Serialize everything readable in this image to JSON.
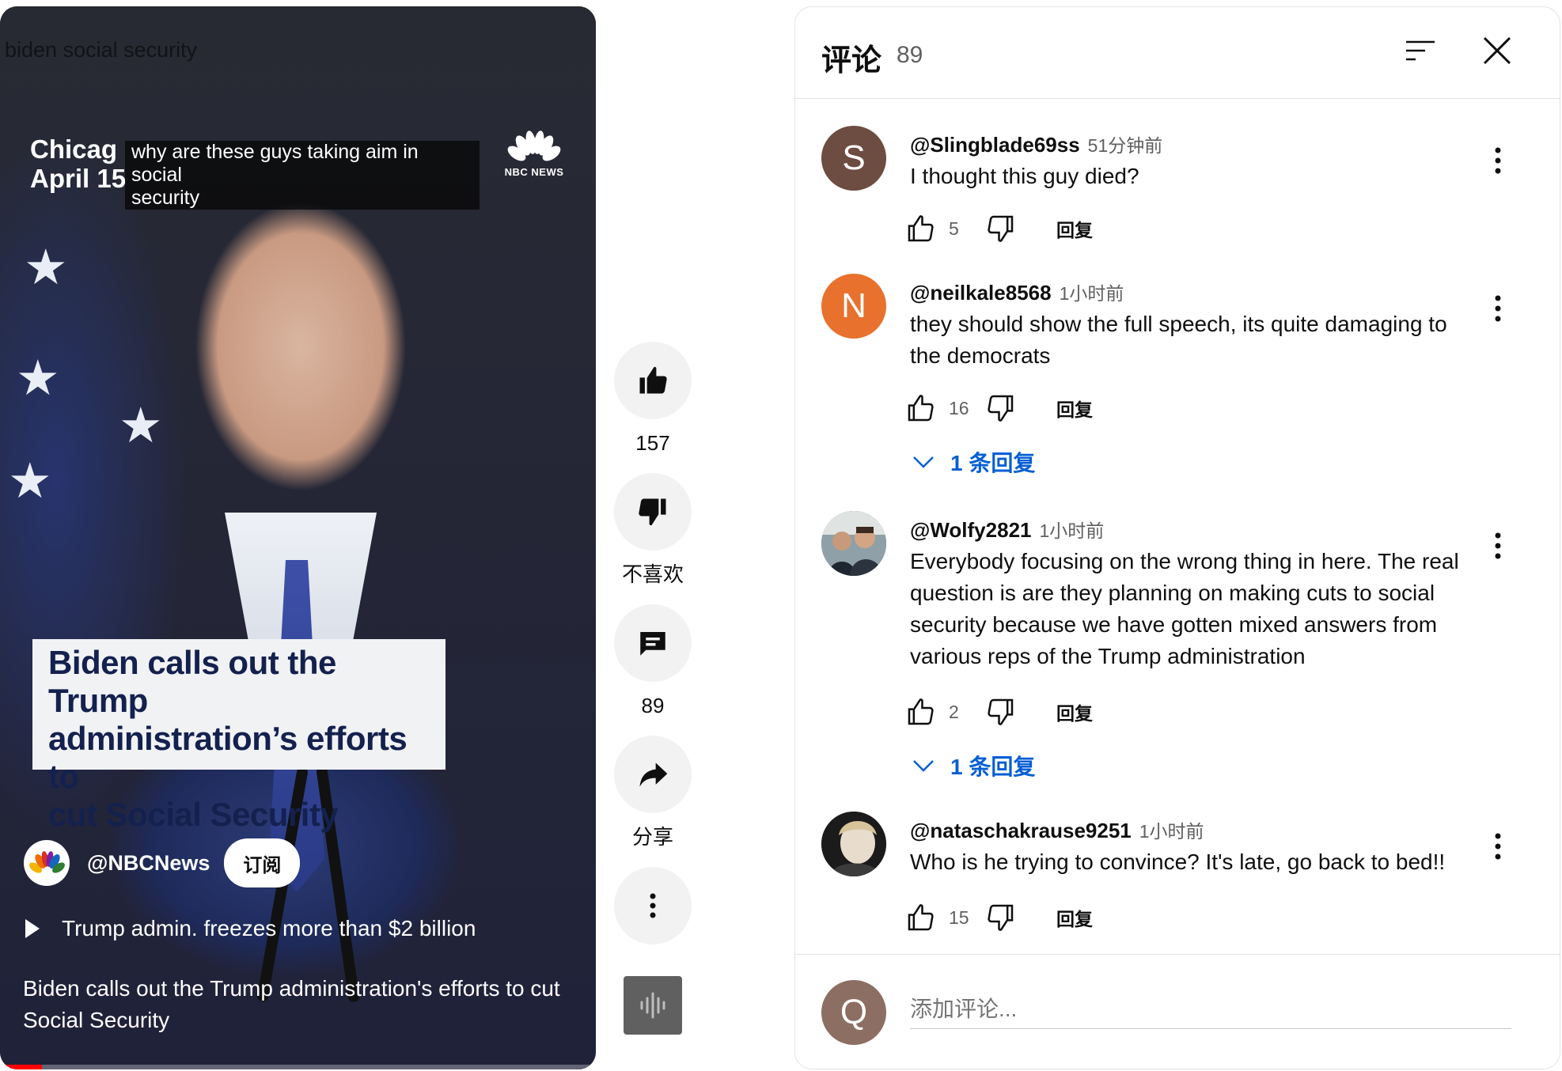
{
  "video": {
    "ghost_title": "biden social security",
    "location_line1": "Chicag",
    "location_line2": "April 15",
    "caption_line1": "why are these guys taking aim in social",
    "caption_line2": "security",
    "network_logo": "NBC NEWS",
    "lower_third": [
      "Biden calls out the Trump",
      "administration’s efforts to",
      "cut Social Security"
    ],
    "channel_name": "@NBCNews",
    "subscribe_label": "订阅",
    "related_title": "Trump admin. freezes more than $2 billion",
    "description": "Biden calls out the Trump administration's efforts to cut Social Security",
    "progress": 0.07,
    "accent_color": "#ff0000"
  },
  "rail": {
    "like_count": "157",
    "dislike_label": "不喜欢",
    "comments_count": "89",
    "share_label": "分享",
    "icons": [
      "thumb-up-icon",
      "thumb-down-icon",
      "comment-icon",
      "share-icon",
      "more-vert-icon",
      "audio-wave-icon"
    ]
  },
  "comments_panel": {
    "title": "评论",
    "count": "89",
    "reply_label": "回复",
    "comments": [
      {
        "handle": "@Slingblade69ss",
        "time": "51分钟前",
        "text": "I thought this guy died?",
        "likes": "5",
        "avatar_letter": "S",
        "avatar_color": "#6d4c41"
      },
      {
        "handle": "@neilkale8568",
        "time": "1小时前",
        "text": "they should show the full speech, its quite damaging to the democrats",
        "likes": "16",
        "avatar_letter": "N",
        "avatar_color": "#e8712d",
        "replies": "1 条回复"
      },
      {
        "handle": "@Wolfy2821",
        "time": "1小时前",
        "text": "Everybody focusing on the wrong thing in here. The real question is are they planning on making cuts to social security because we have gotten mixed answers from various reps of the Trump administration",
        "likes": "2",
        "replies": "1 条回复"
      },
      {
        "handle": "@nataschakrause9251",
        "time": "1小时前",
        "text": "Who is he trying to convince?  It's late, go back to bed!!",
        "likes": "15"
      }
    ],
    "composer": {
      "avatar_letter": "Q",
      "placeholder": "添加评论..."
    },
    "link_color": "#065fd4"
  }
}
